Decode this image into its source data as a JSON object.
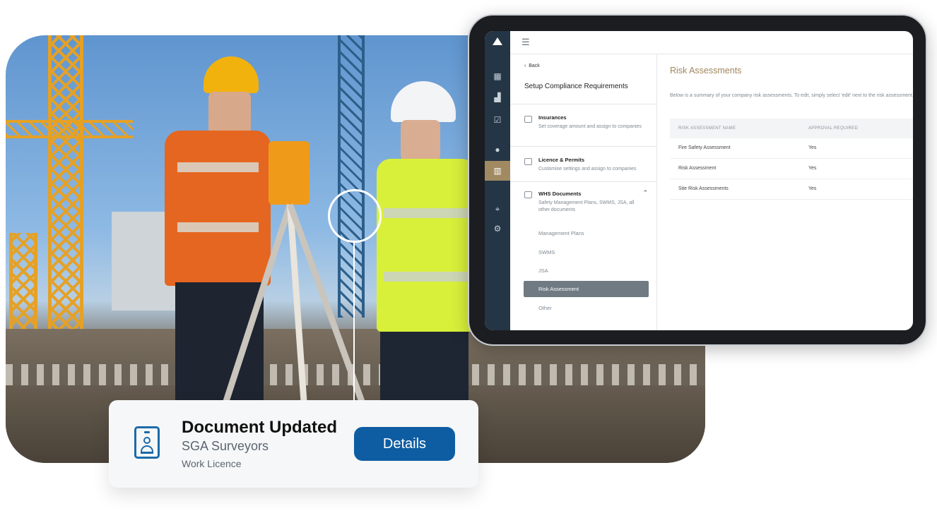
{
  "notification": {
    "title": "Document Updated",
    "company": "SGA Surveyors",
    "document": "Work Licence",
    "button_label": "Details",
    "icon": "id-badge-icon",
    "accent_color": "#0e5da3"
  },
  "tablet": {
    "left_pane": {
      "back_label": "Back",
      "title": "Setup Compliance Requirements",
      "sections": [
        {
          "title": "Insurances",
          "desc": "Set coverage amount and assign to companies",
          "icon": "document-icon"
        },
        {
          "title": "Licence & Permits",
          "desc": "Customise settings and assign to companies",
          "icon": "licence-card-icon"
        },
        {
          "title": "WHS Documents",
          "desc": "Safety Management Plans, SWMS, JSA, all other documents",
          "icon": "folder-icon"
        }
      ],
      "subitems": [
        "Management Plans",
        "SWMS",
        "JSA",
        "Risk Assessment",
        "Other"
      ],
      "active_subitem": "Risk Assessment"
    },
    "main": {
      "title": "Risk Assessments",
      "description": "Below is a summary of your company risk assessments. To edit, simply select 'edit' next to the risk assessment. To add a new risk assessment select 'New risk assessment'.",
      "table": {
        "headers": [
          "RISK ASSESSMENT NAME",
          "APPROVAL REQUIRED"
        ],
        "rows": [
          [
            "Fire Safety Assessment",
            "Yes"
          ],
          [
            "Risk Assessment",
            "Yes"
          ],
          [
            "Site Risk Assessments",
            "Yes"
          ]
        ]
      }
    },
    "rail_icons": [
      "dashboard-icon",
      "chart-icon",
      "checklist-icon",
      "user-icon",
      "building-icon",
      "location-pin-icon",
      "settings-icon"
    ],
    "accent_color": "#a0865d",
    "rail_color": "#243545"
  },
  "photo": {
    "subject": "two-surveyors-with-theodolite-construction-site"
  }
}
